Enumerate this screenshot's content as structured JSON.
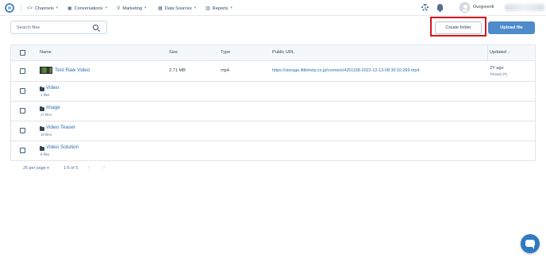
{
  "nav": {
    "items": [
      {
        "label": "Channels",
        "icon": "code-icon"
      },
      {
        "label": "Conversations",
        "icon": "inbox-icon"
      },
      {
        "label": "Marketing",
        "icon": "broadcast-icon"
      },
      {
        "label": "Data Sources",
        "icon": "grid-icon"
      },
      {
        "label": "Reports",
        "icon": "bar-chart-icon"
      }
    ],
    "username": "Ourgreenfi"
  },
  "toolbar": {
    "search_placeholder": "Search files",
    "create_folder_label": "Create folder",
    "upload_file_label": "Upload file"
  },
  "table": {
    "columns": {
      "name": "Name",
      "size": "Size",
      "type": "Type",
      "url": "Public URL",
      "updated": "Updated"
    },
    "sort_indicator": "↓",
    "file": {
      "name": "Test Raw Video",
      "size": "2.71 MB",
      "type": "mp4",
      "url": "https://storage.littlehelp.co.jp/connect/4351158-2022-12-13-08:30:10.269.mp4",
      "updated": "2Y ago",
      "updated_sub": "Thread (IT)"
    },
    "folders": [
      {
        "name": "Video",
        "count": "1 files"
      },
      {
        "name": "Image",
        "count": "17 files"
      },
      {
        "name": "Video Teaser",
        "count": "10 files"
      },
      {
        "name": "Video Solution",
        "count": "9 files"
      }
    ]
  },
  "pagination": {
    "per_page": "25 per page",
    "range": "1-5 of 5"
  },
  "colors": {
    "accent": "#4d8bcb",
    "link": "#2b6cb0",
    "highlight": "#d6161c"
  }
}
